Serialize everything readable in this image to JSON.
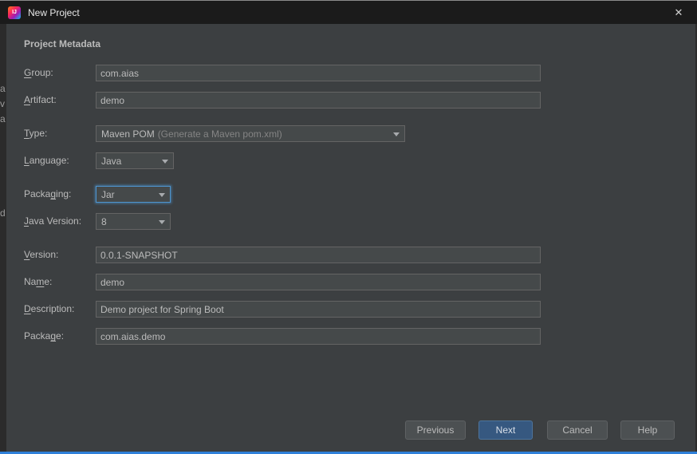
{
  "window": {
    "title": "New Project",
    "logo_text": "IJ",
    "close": "✕"
  },
  "header": {
    "title": "Project Metadata"
  },
  "form": {
    "fields": [
      {
        "label": "Group:",
        "mnemonic": 0,
        "value": "com.aias"
      },
      {
        "label": "Artifact:",
        "mnemonic": 0,
        "value": "demo"
      },
      {
        "label": "Type:",
        "mnemonic": 0,
        "value": "Maven POM",
        "hint": "(Generate a Maven pom.xml)"
      },
      {
        "label": "Language:",
        "mnemonic": 0,
        "value": "Java"
      },
      {
        "label": "Packaging:",
        "mnemonic": 5,
        "value": "Jar"
      },
      {
        "label": "Java Version:",
        "mnemonic": 0,
        "value": "8"
      },
      {
        "label": "Version:",
        "mnemonic": 0,
        "value": "0.0.1-SNAPSHOT"
      },
      {
        "label": "Name:",
        "mnemonic": 2,
        "value": "demo"
      },
      {
        "label": "Description:",
        "mnemonic": 0,
        "value": "Demo project for Spring Boot"
      },
      {
        "label": "Package:",
        "mnemonic": 5,
        "value": "com.aias.demo"
      }
    ]
  },
  "buttons": {
    "previous": "Previous",
    "next": "Next",
    "cancel": "Cancel",
    "help": "Help"
  },
  "background_fragments": [
    {
      "char": "a"
    },
    {
      "char": "v"
    },
    {
      "char": "a"
    },
    {
      "char": "d"
    }
  ],
  "colors": {
    "dialog_background": "#3c3f41",
    "titlebar_background": "#1b1b1b",
    "field_background": "#45494a",
    "field_border": "#646464",
    "focus_border": "#4e94ce",
    "default_button": "#365880",
    "window_bottom_accent": "#2f80d9",
    "text": "#bbbbbb"
  }
}
